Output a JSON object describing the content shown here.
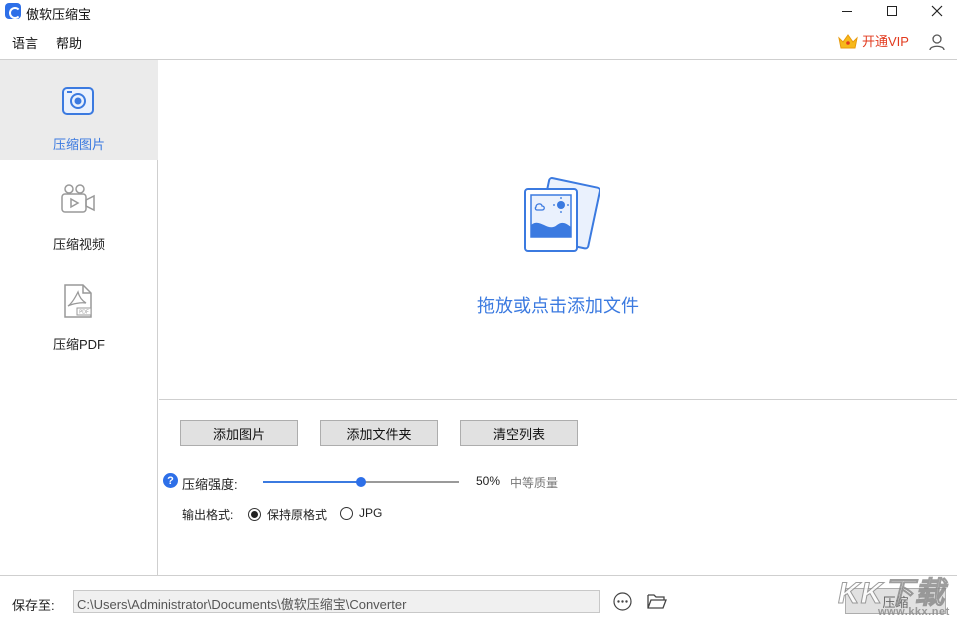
{
  "window": {
    "title": "傲软压缩宝",
    "logo_icon": "app-logo-icon"
  },
  "menu": {
    "language": "语言",
    "help": "帮助"
  },
  "vip": {
    "label": "开通VIP",
    "icon": "crown-icon",
    "color": "#e23a1e"
  },
  "sidebar": {
    "items": [
      {
        "label": "压缩图片",
        "icon": "image-compress-icon",
        "active": true
      },
      {
        "label": "压缩视频",
        "icon": "video-camera-icon",
        "active": false
      },
      {
        "label": "压缩PDF",
        "icon": "pdf-file-icon",
        "active": false
      }
    ]
  },
  "dropzone": {
    "text": "拖放或点击添加文件",
    "icon": "photo-stack-icon"
  },
  "buttons": {
    "add_image": "添加图片",
    "add_folder": "添加文件夹",
    "clear_list": "清空列表"
  },
  "compression": {
    "label": "压缩强度:",
    "value_percent": 50,
    "value_text": "50%",
    "quality_text": "中等质量"
  },
  "output_format": {
    "label": "输出格式:",
    "options": [
      {
        "label": "保持原格式",
        "selected": true
      },
      {
        "label": "JPG",
        "selected": false
      }
    ]
  },
  "save": {
    "label": "保存至:",
    "path": "C:\\Users\\Administrator\\Documents\\傲软压缩宝\\Converter",
    "compress_button": "压缩"
  },
  "watermark": {
    "big": "KK下载",
    "small": "www.kkx.net"
  },
  "colors": {
    "accent": "#3b7ae0",
    "vip": "#e23a1e",
    "active_bg": "#ebebeb"
  }
}
